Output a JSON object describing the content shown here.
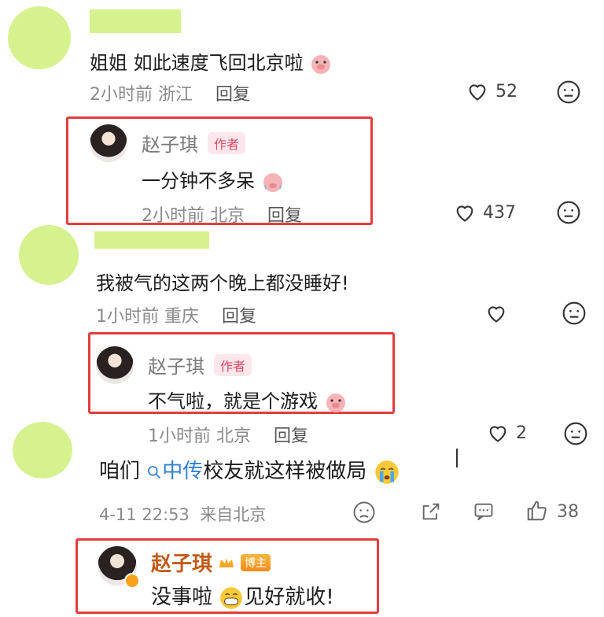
{
  "comments": [
    {
      "text": "姐姐 如此速度飞回北京啦",
      "time": "2小时前",
      "location": "浙江",
      "reply_label": "回复",
      "likes": "52",
      "reply": {
        "name": "赵子琪",
        "tag": "作者",
        "text": "一分钟不多呆",
        "time": "2小时前",
        "location": "北京",
        "reply_label": "回复",
        "likes": "437"
      }
    },
    {
      "text": "我被气的这两个晚上都没睡好!",
      "time": "1小时前",
      "location": "重庆",
      "reply_label": "回复",
      "likes": "",
      "reply": {
        "name": "赵子琪",
        "tag": "作者",
        "text": "不气啦，就是个游戏",
        "time": "1小时前",
        "location": "北京",
        "reply_label": "回复",
        "likes": "2"
      }
    }
  ],
  "weibo_comment": {
    "text_before": "咱们",
    "topic": "中传",
    "text_after": "校友就这样被做局",
    "date": "4-11 22:53",
    "source": "来自北京",
    "likes": "38",
    "reply": {
      "name": "赵子琪",
      "tag": "博主",
      "text_before": "没事啦",
      "text_after": "见好就收!"
    }
  },
  "colors": {
    "highlight_box": "#e33d3d",
    "author_tag": "#e24a62",
    "topic_link": "#2f7fd6",
    "censor_green": "#d6f28e"
  }
}
